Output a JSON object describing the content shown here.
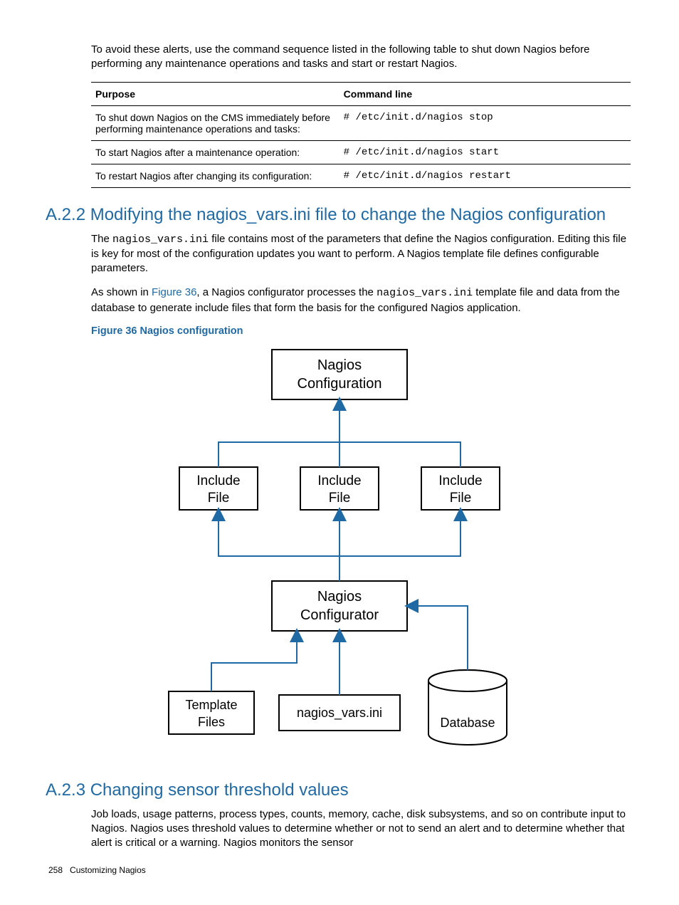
{
  "intro_para": "To avoid these alerts, use the command sequence listed in the following table to shut down Nagios before performing any maintenance operations and tasks and start or restart Nagios.",
  "table": {
    "headers": {
      "purpose": "Purpose",
      "cmd": "Command line"
    },
    "rows": [
      {
        "purpose": "To shut down Nagios on the CMS immediately before performing maintenance operations and tasks:",
        "cmd": "# /etc/init.d/nagios stop"
      },
      {
        "purpose": "To start Nagios after a maintenance operation:",
        "cmd": "# /etc/init.d/nagios start"
      },
      {
        "purpose": "To restart Nagios after changing its configuration:",
        "cmd": "# /etc/init.d/nagios restart"
      }
    ]
  },
  "sec_a22": {
    "heading": "A.2.2 Modifying the nagios_vars.ini file to change the Nagios configuration",
    "p1_a": "The ",
    "p1_code": "nagios_vars.ini",
    "p1_b": " file contains most of the parameters that define the Nagios configuration. Editing this file is key for most of the configuration updates you want to perform. A Nagios template file defines configurable parameters.",
    "p2_a": "As shown in ",
    "p2_link": "Figure 36",
    "p2_b": ", a Nagios configurator processes the ",
    "p2_code": "nagios_vars.ini",
    "p2_c": " template file and data from the database to generate include files that form the basis for the configured Nagios application.",
    "fig_caption": "Figure 36 Nagios configuration"
  },
  "diagram": {
    "nagios_conf_l1": "Nagios",
    "nagios_conf_l2": "Configuration",
    "include_l1": "Include",
    "include_l2": "File",
    "configur_l1": "Nagios",
    "configur_l2": "Configurator",
    "template_l1": "Template",
    "template_l2": "Files",
    "vars": "nagios_vars.ini",
    "db": "Database"
  },
  "sec_a23": {
    "heading": "A.2.3 Changing sensor threshold values",
    "p1": "Job loads, usage patterns, process types, counts, memory, cache, disk subsystems, and so on contribute input to Nagios. Nagios uses threshold values to determine whether or not to send an alert and to determine whether that alert is critical or a warning. Nagios monitors the sensor"
  },
  "footer": {
    "page": "258",
    "title": "Customizing Nagios"
  }
}
